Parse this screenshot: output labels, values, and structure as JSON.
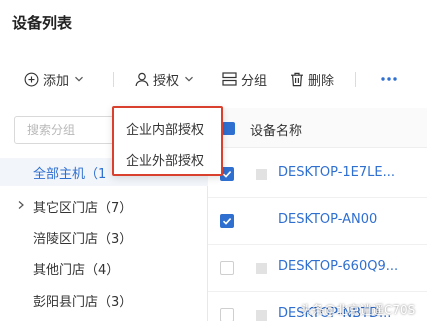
{
  "page_title": "设备列表",
  "toolbar": {
    "add_label": "添加",
    "authorize_label": "授权",
    "group_label": "分组",
    "delete_label": "删除"
  },
  "authorize_menu": {
    "items": [
      "企业内部授权",
      "企业外部授权"
    ]
  },
  "sidebar": {
    "search_placeholder": "搜索分组",
    "items": [
      {
        "label": "全部主机（1",
        "active": true
      },
      {
        "label": "其它区门店（7）",
        "active": false
      },
      {
        "label": "涪陵区门店（3）",
        "active": false
      },
      {
        "label": "其他门店（4）",
        "active": false
      },
      {
        "label": "彭阳县门店（3）",
        "active": false
      }
    ]
  },
  "table": {
    "column_name": "设备名称",
    "rows": [
      {
        "name": "DESKTOP-1E7LE...",
        "checked": true
      },
      {
        "name": "DESKTOP-AN00",
        "checked": true
      },
      {
        "name": "DESKTOP-660Q9...",
        "checked": false
      },
      {
        "name": "DESKTOP-NBTD...",
        "checked": false
      }
    ]
  },
  "watermark": "头条@北京逍遥C70S",
  "colors": {
    "accent": "#2f6fd0",
    "highlight_border": "#d9412e"
  }
}
